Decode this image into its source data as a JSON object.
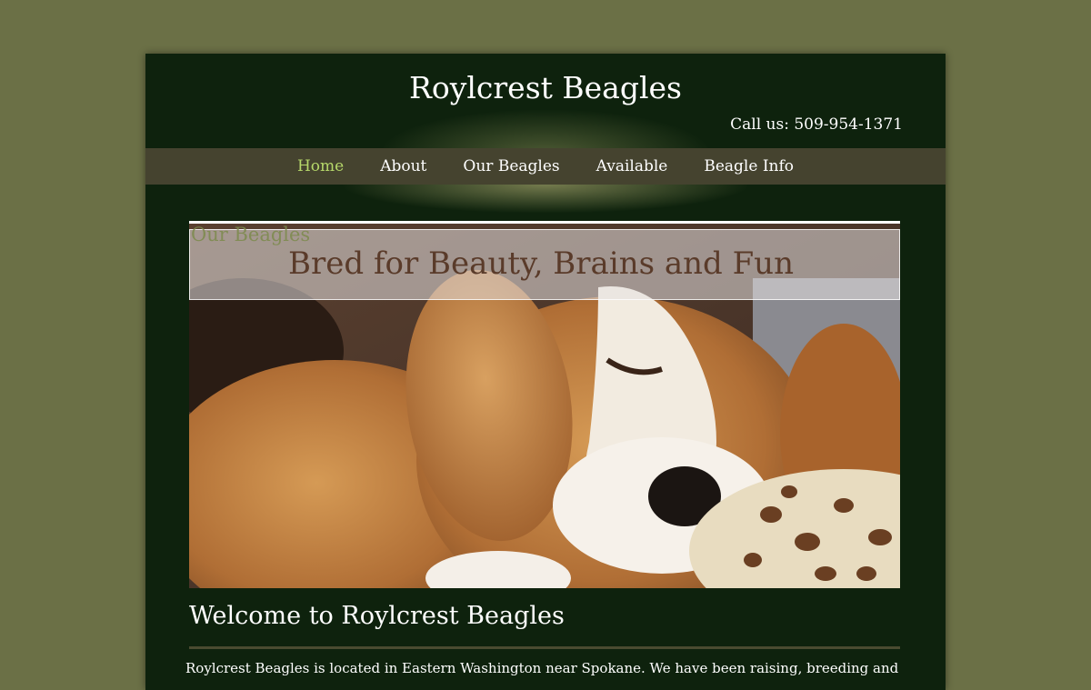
{
  "header": {
    "site_title": "Roylcrest Beagles",
    "phone": "Call us: 509-954-1371"
  },
  "nav": {
    "items": [
      {
        "label": "Home",
        "active": true
      },
      {
        "label": "About",
        "active": false
      },
      {
        "label": "Our Beagles",
        "active": false
      },
      {
        "label": "Available",
        "active": false
      },
      {
        "label": "Beagle Info",
        "active": false
      }
    ]
  },
  "hero": {
    "section_label": "Our Beagles",
    "caption": "Bred for Beauty, Brains and Fun"
  },
  "main": {
    "heading": "Welcome to Roylcrest Beagles",
    "intro": "Roylcrest Beagles is located in Eastern Washington near Spokane.  We have been raising, breeding and"
  },
  "colors": {
    "background": "#6b7046",
    "page": "#0e220d",
    "nav_bar": "#45432f",
    "nav_active": "#b6d86a",
    "caption_text": "#5a3b2a"
  }
}
